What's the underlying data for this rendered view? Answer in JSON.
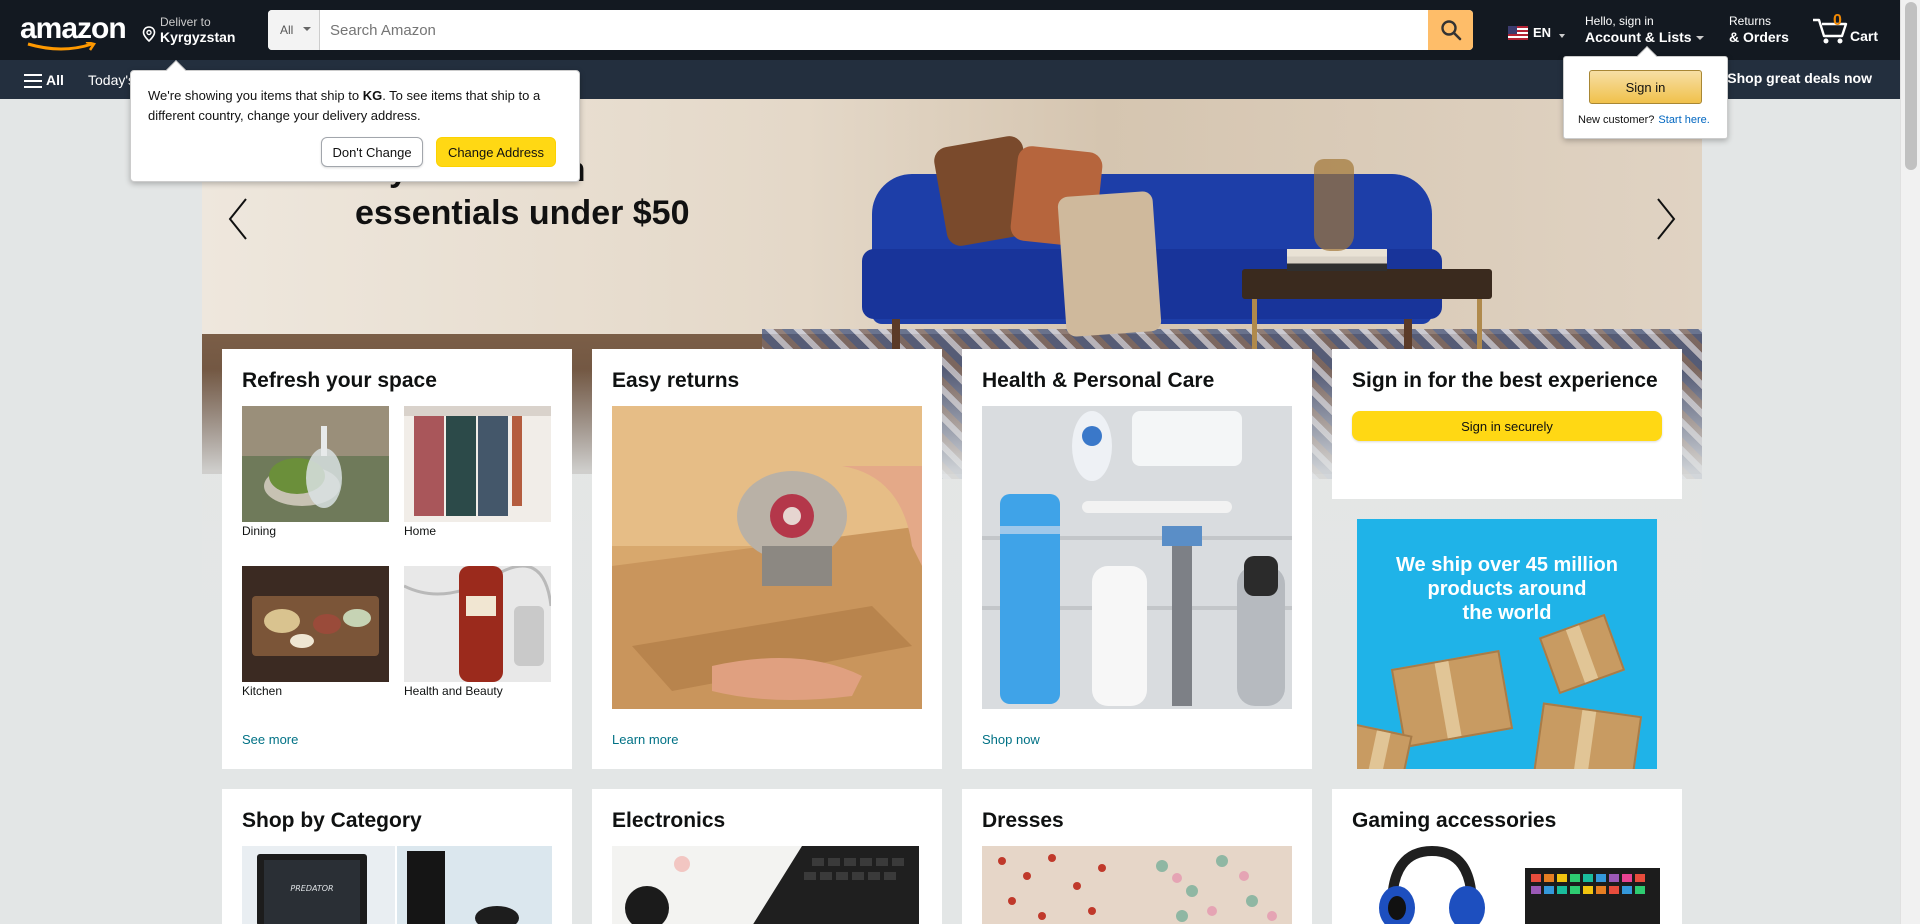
{
  "header": {
    "logo_text": "amazon",
    "deliver_label": "Deliver to",
    "deliver_location": "Kyrgyzstan",
    "search": {
      "category": "All",
      "placeholder": "Search Amazon"
    },
    "language": "EN",
    "account_greeting": "Hello, sign in",
    "account_label": "Account & Lists",
    "returns_label": "Returns",
    "orders_label": "& Orders",
    "cart_count": "0",
    "cart_label": "Cart"
  },
  "subnav": {
    "all_label": "All",
    "today_label": "Today's",
    "promo_label": "Shop great deals now"
  },
  "delivery_popover": {
    "message_pre": "We're showing you items that ship to ",
    "country_code": "KG",
    "message_post": ". To see items that ship to a different country, change your delivery address.",
    "dont_change": "Don't Change",
    "change_address": "Change Address"
  },
  "account_flyout": {
    "sign_in_button": "Sign in",
    "new_customer": "New customer?",
    "start_here": "Start here."
  },
  "hero": {
    "headline_line1": "…y home with",
    "headline_line2": "essentials under $50"
  },
  "cards": {
    "refresh": {
      "title": "Refresh your space",
      "tiles": [
        "Dining",
        "Home",
        "Kitchen",
        "Health and Beauty"
      ],
      "footer": "See more"
    },
    "returns": {
      "title": "Easy returns",
      "footer": "Learn more"
    },
    "health": {
      "title": "Health & Personal Care",
      "footer": "Shop now"
    },
    "signin": {
      "title": "Sign in for the best experience",
      "button": "Sign in securely"
    },
    "ship_ad": {
      "line1": "We ship over 45 million",
      "line2": "products around",
      "line3": "the world"
    },
    "row2": {
      "category": "Shop by Category",
      "electronics": "Electronics",
      "dresses": "Dresses",
      "gaming": "Gaming accessories"
    }
  },
  "colors": {
    "nav_dark": "#131921",
    "nav_sub": "#232f3e",
    "search_button": "#febd69",
    "yellow_button": "#ffd814",
    "link_teal": "#007185",
    "ship_ad_blue": "#1fb3e8"
  }
}
